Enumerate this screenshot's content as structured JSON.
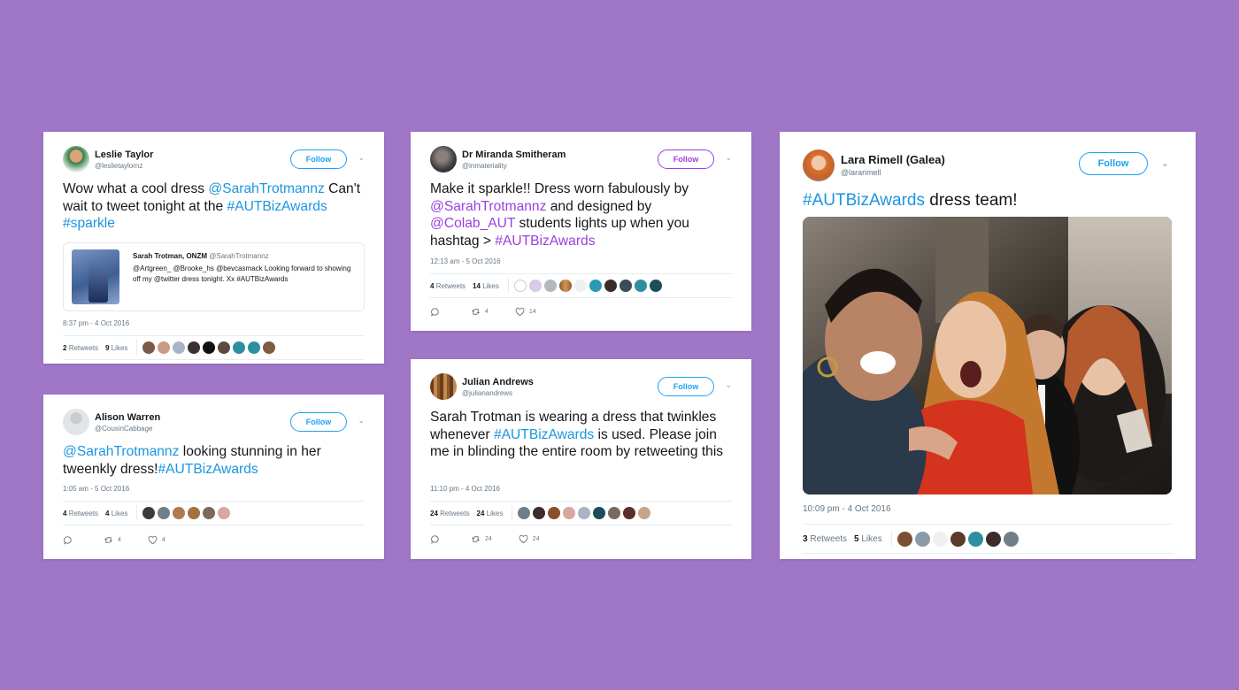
{
  "tweets": {
    "leslie": {
      "name": "Leslie Taylor",
      "handle": "@leslietaylornz",
      "follow": "Follow",
      "text": [
        "Wow what a cool dress ",
        "@SarahTrotmannz",
        " Can't wait to tweet tonight at the ",
        "#AUTBizAwards",
        " ",
        "#sparkle"
      ],
      "quote": {
        "name": "Sarah Trotman, ONZM",
        "handle": "@SarahTrotmannz",
        "text": "@Artgreen_ @Brooke_hs @bevcasmack Looking forward to showing off my @twitter dress tonight. Xx #AUTBizAwards"
      },
      "time": "8:37 pm - 4 Oct 2016",
      "retweets": "2",
      "retweets_label": "Retweets",
      "likes": "9",
      "likes_label": "Likes"
    },
    "alison": {
      "name": "Alison Warren",
      "handle": "@CousinCabbage",
      "follow": "Follow",
      "text": [
        "@SarahTrotmannz",
        " looking stunning in her tweenkly dress!",
        "#AUTBizAwards"
      ],
      "time": "1:05 am - 5 Oct 2016",
      "retweets": "4",
      "retweets_label": "Retweets",
      "likes": "4",
      "likes_label": "Likes",
      "action_rt": "4",
      "action_like": "4"
    },
    "miranda": {
      "name": "Dr Miranda Smitheram",
      "handle": "@inmateriality",
      "follow": "Follow",
      "text": [
        "Make it sparkle!! Dress worn fabulously by ",
        "@SarahTrotmannz",
        " and designed by ",
        "@Colab_AUT",
        " students lights up when you hashtag > ",
        "#AUTBizAwards"
      ],
      "time": "12:13 am - 5 Oct 2016",
      "retweets": "4",
      "retweets_label": "Retweets",
      "likes": "14",
      "likes_label": "Likes",
      "action_rt": "4",
      "action_like": "14"
    },
    "julian": {
      "name": "Julian Andrews",
      "handle": "@julianandrews",
      "follow": "Follow",
      "text": [
        "Sarah Trotman is wearing a dress that twinkles whenever ",
        "#AUTBizAwards",
        " is used. Please join me in blinding the entire room by retweeting this"
      ],
      "time": "11:10 pm - 4 Oct 2016",
      "retweets": "24",
      "retweets_label": "Retweets",
      "likes": "24",
      "likes_label": "Likes",
      "action_rt": "24",
      "action_like": "24"
    },
    "lara": {
      "name": "Lara Rimell (Galea)",
      "handle": "@lararimell",
      "follow": "Follow",
      "text": [
        "#AUTBizAwards",
        " dress team!"
      ],
      "time": "10:09 pm - 4 Oct 2016",
      "retweets": "3",
      "retweets_label": "Retweets",
      "likes": "5",
      "likes_label": "Likes"
    }
  },
  "colors": {
    "background": "#a076c7",
    "link_blue": "#1b95e0",
    "link_purple": "#9b3fe0"
  },
  "icons": {
    "reply": "reply-icon",
    "retweet": "retweet-icon",
    "like": "heart-icon",
    "more": "chevron-down-icon"
  }
}
